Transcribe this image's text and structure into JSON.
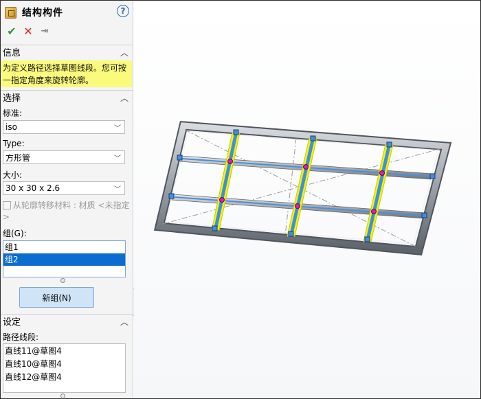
{
  "panel": {
    "title": "结构构件",
    "help_glyph": "?",
    "actions": {
      "ok": "✔",
      "cancel": "✕",
      "pin": "⇥"
    }
  },
  "info": {
    "header": "信息",
    "text": "为定义路径选择草图线段。您可按一指定角度来旋转轮廓。"
  },
  "selection": {
    "header": "选择",
    "standard_label": "标准:",
    "standard_value": "iso",
    "type_label": "Type:",
    "type_value": "方形管",
    "size_label": "大小:",
    "size_value": "30 x 30 x 2.6",
    "transfer_material_label": "从轮廓转移材料 : 材质 <未指定>",
    "group_label": "组(G):",
    "groups": [
      "组1",
      "组2"
    ],
    "selected_group": "组2",
    "new_group_button": "新组(N)"
  },
  "settings": {
    "header": "设定",
    "path_segments_label": "路径线段:",
    "path_segments": [
      "直线11@草图4",
      "直线10@草图4",
      "直线12@草图4"
    ]
  },
  "colors": {
    "selection_highlight": "#f5f500",
    "member_blue": "#3d8ee6",
    "frame_gray": "#9aa0a8",
    "list_selected": "#0c6cd0",
    "info_background": "#fafa7c"
  }
}
